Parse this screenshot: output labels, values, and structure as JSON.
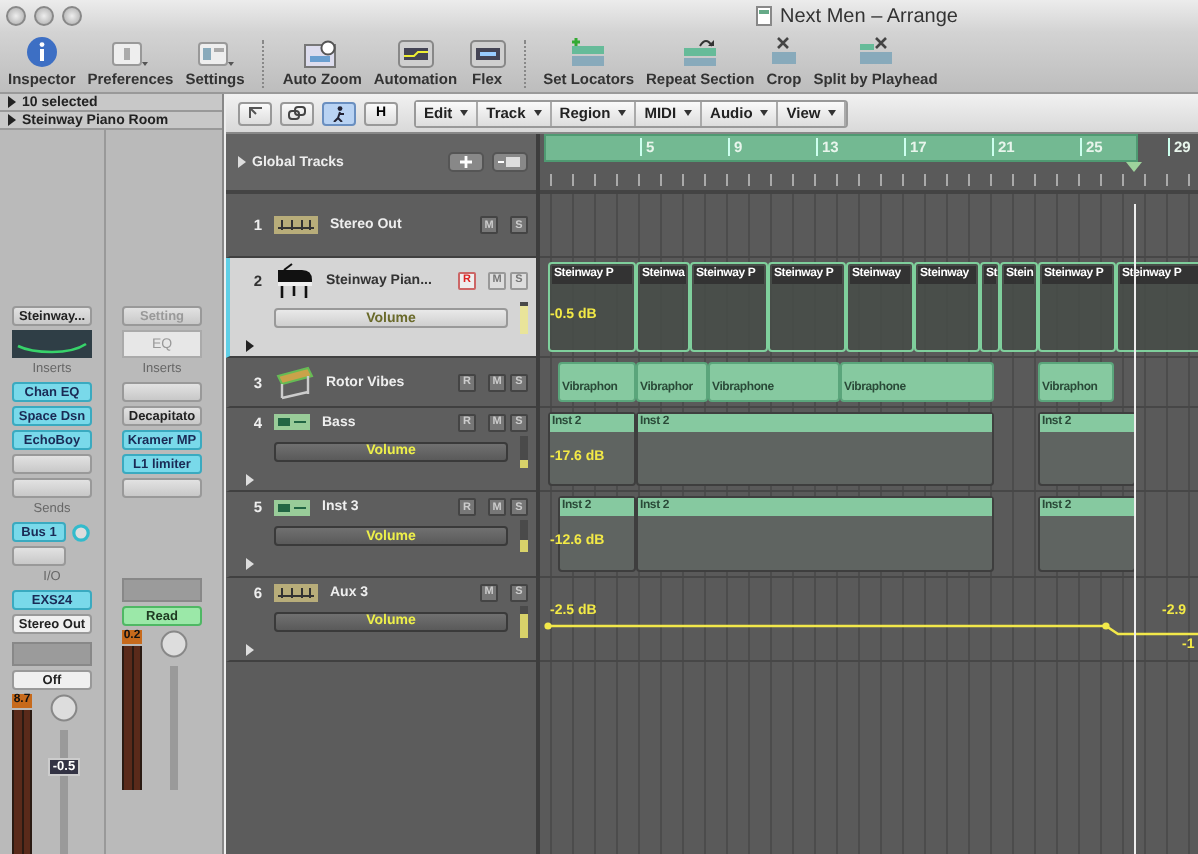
{
  "window": {
    "title": "Next Men – Arrange"
  },
  "toolbar": {
    "groups": [
      [
        {
          "kind": "info",
          "label": "Inspector"
        },
        {
          "kind": "prefs",
          "label": "Preferences"
        },
        {
          "kind": "settings",
          "label": "Settings"
        }
      ],
      [
        {
          "kind": "zoom",
          "label": "Auto Zoom"
        },
        {
          "kind": "automation",
          "label": "Automation"
        },
        {
          "kind": "flex",
          "label": "Flex"
        }
      ],
      [
        {
          "kind": "locators",
          "label": "Set Locators"
        },
        {
          "kind": "repeat",
          "label": "Repeat Section"
        },
        {
          "kind": "crop",
          "label": "Crop"
        },
        {
          "kind": "split",
          "label": "Split by Playhead"
        }
      ]
    ]
  },
  "inspector": {
    "rows": [
      "10 selected",
      "Steinway Piano Room"
    ]
  },
  "channel_strips": [
    {
      "setting": {
        "label": "Steinway...",
        "disabled": false
      },
      "eq": {
        "kind": "curve"
      },
      "inserts_heading": "Inserts",
      "inserts": [
        {
          "label": "Chan EQ",
          "active": true
        },
        {
          "label": "Space Dsn",
          "active": true
        },
        {
          "label": "EchoBoy",
          "active": true
        },
        {
          "active": false
        },
        {
          "active": false
        }
      ],
      "sends_heading": "Sends",
      "sends": [
        {
          "label": "Bus 1",
          "active": true
        },
        {
          "active": false
        }
      ],
      "io_heading": "I/O",
      "io": [
        {
          "label": "EXS24",
          "active": true
        },
        {
          "label": "Stereo Out",
          "active": false
        }
      ],
      "automation": {
        "label": "Off",
        "selected": false
      },
      "peak": "8.7",
      "fader_value": "-0.5"
    },
    {
      "setting": {
        "label": "Setting",
        "disabled": true
      },
      "eq": {
        "kind": "text",
        "label": "EQ"
      },
      "inserts_heading": "Inserts",
      "inserts": [
        {
          "active": false
        },
        {
          "label": "Decapitato",
          "active": false
        },
        {
          "label": "Kramer MP",
          "active": true
        },
        {
          "label": "L1 limiter",
          "active": true
        },
        {
          "active": false
        }
      ],
      "automation": {
        "label": "Read",
        "selected": true
      },
      "peak": "0.2"
    }
  ],
  "arrange_toolbar": {
    "tool_buttons": [
      {
        "kind": "arrow",
        "selected": false
      },
      {
        "kind": "link",
        "selected": false
      },
      {
        "kind": "catch",
        "selected": true
      },
      {
        "kind": "text",
        "label": "H",
        "selected": false
      }
    ],
    "menus": [
      "Edit",
      "Track",
      "Region",
      "MIDI",
      "Audio",
      "View"
    ]
  },
  "global_tracks": {
    "label": "Global Tracks"
  },
  "ruler": {
    "cycle": true,
    "bars": [
      "5",
      "9",
      "13",
      "17",
      "21",
      "25",
      "29"
    ]
  },
  "tracks": [
    {
      "number": "1",
      "name": "Stereo Out",
      "kind": "output",
      "selected": false,
      "buttons": [
        {
          "label": "M",
          "on": false
        },
        {
          "label": "S",
          "on": false
        }
      ]
    },
    {
      "number": "2",
      "name": "Steinway Pian...",
      "kind": "piano",
      "selected": true,
      "buttons": [
        {
          "label": "R",
          "on": true
        },
        {
          "label": "M",
          "on": false
        },
        {
          "label": "S",
          "on": false
        }
      ],
      "automation": {
        "label": "Volume",
        "level": 0.85
      },
      "value": "-0.5 dB",
      "regions": [
        {
          "label": "Steinway P"
        },
        {
          "label": "Steinwa"
        },
        {
          "label": "Steinway P"
        },
        {
          "label": "Steinway P"
        },
        {
          "label": "Steinway"
        },
        {
          "label": "Steinway"
        },
        {
          "label": "St"
        },
        {
          "label": "Stein"
        },
        {
          "label": "Steinway P"
        },
        {
          "label": "Steinway P"
        }
      ]
    },
    {
      "number": "3",
      "name": "Rotor Vibes",
      "kind": "vibes",
      "selected": false,
      "buttons": [
        {
          "label": "R",
          "on": false
        },
        {
          "label": "M",
          "on": false
        },
        {
          "label": "S",
          "on": false
        }
      ],
      "regions": [
        {
          "label": "Vibraphon"
        },
        {
          "label": "Vibraphor"
        },
        {
          "label": "Vibraphone"
        },
        {
          "label": "Vibraphone"
        },
        {
          "label": "Vibraphon"
        }
      ]
    },
    {
      "number": "4",
      "name": "Bass",
      "kind": "instrument",
      "selected": false,
      "buttons": [
        {
          "label": "R",
          "on": false
        },
        {
          "label": "M",
          "on": false
        },
        {
          "label": "S",
          "on": false
        }
      ],
      "automation": {
        "label": "Volume",
        "level": 0.2
      },
      "value": "-17.6 dB",
      "regions": [
        {
          "label": "Inst 2"
        },
        {
          "label": "Inst 2"
        },
        {
          "label": "Inst 2"
        }
      ]
    },
    {
      "number": "5",
      "name": "Inst 3",
      "kind": "instrument",
      "selected": false,
      "buttons": [
        {
          "label": "R",
          "on": false
        },
        {
          "label": "M",
          "on": false
        },
        {
          "label": "S",
          "on": false
        }
      ],
      "automation": {
        "label": "Volume",
        "level": 0.4
      },
      "value": "-12.6 dB",
      "regions": [
        {
          "label": "Inst 2"
        },
        {
          "label": "Inst 2"
        },
        {
          "label": "Inst 2"
        }
      ]
    },
    {
      "number": "6",
      "name": "Aux 3",
      "kind": "aux",
      "selected": false,
      "buttons": [
        {
          "label": "M",
          "on": false
        },
        {
          "label": "S",
          "on": false
        }
      ],
      "automation": {
        "label": "Volume",
        "level": 0.7
      },
      "value": "-2.5 dB",
      "end_values": [
        "-2.9",
        "-1"
      ]
    }
  ]
}
